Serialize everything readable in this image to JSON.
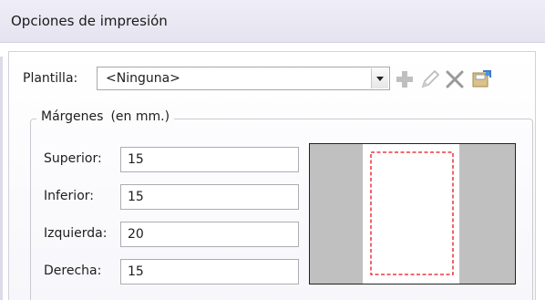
{
  "header": {
    "title": "Opciones de impresión"
  },
  "template": {
    "label": "Plantilla:",
    "selected": "<Ninguna>"
  },
  "toolbar": {
    "icons": [
      "add-icon",
      "edit-icon",
      "delete-icon",
      "save-icon"
    ]
  },
  "margins": {
    "legend": "Márgenes",
    "units": "(en mm.)",
    "fields": [
      {
        "label": "Superior:",
        "value": "15"
      },
      {
        "label": "Inferior:",
        "value": "15"
      },
      {
        "label": "Izquierda:",
        "value": "20"
      },
      {
        "label": "Derecha:",
        "value": "15"
      }
    ]
  },
  "colors": {
    "preview_page": "#ffffff",
    "preview_margin": "#c0c0c0",
    "preview_border_dash": "#e8131d",
    "disabled_icon": "#bfbfbf"
  }
}
